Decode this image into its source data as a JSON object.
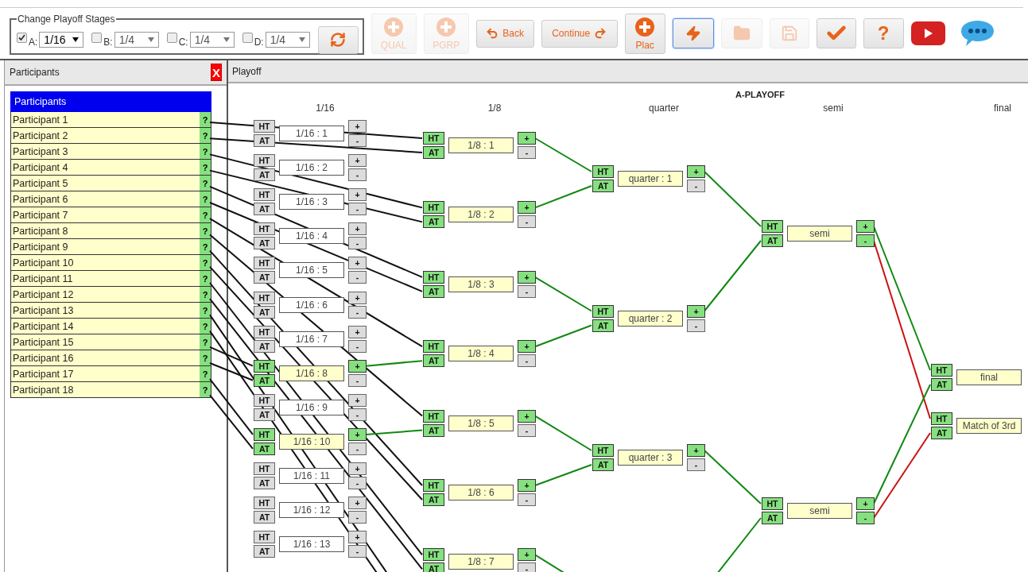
{
  "stage_panel": {
    "legend": "Change Playoff Stages",
    "stages": [
      {
        "letter": "A:",
        "checked": true,
        "value": "1/16"
      },
      {
        "letter": "B:",
        "checked": false,
        "value": "1/4"
      },
      {
        "letter": "C:",
        "checked": false,
        "value": "1/4"
      },
      {
        "letter": "D:",
        "checked": false,
        "value": "1/4"
      }
    ],
    "refresh_button": {
      "disabled": false
    }
  },
  "toolbar": [
    {
      "kind": "qual",
      "label": "QUAL",
      "disabled": true,
      "selected": false
    },
    {
      "kind": "pgrp",
      "label": "PGRP",
      "disabled": true,
      "selected": false
    },
    {
      "kind": "back",
      "label": "Back",
      "disabled": false,
      "selected": false
    },
    {
      "kind": "continue",
      "label": "Continue",
      "disabled": false,
      "selected": false
    },
    {
      "kind": "plac",
      "label": "Plac",
      "disabled": false,
      "selected": false
    },
    {
      "kind": "quick",
      "disabled": false,
      "selected": true
    },
    {
      "kind": "folder",
      "disabled": true,
      "selected": false
    },
    {
      "kind": "save",
      "disabled": true,
      "selected": false
    },
    {
      "kind": "check",
      "disabled": false,
      "selected": false
    },
    {
      "kind": "help",
      "label": "?",
      "disabled": false,
      "selected": false
    },
    {
      "kind": "video",
      "disabled": false,
      "selected": false
    },
    {
      "kind": "chat",
      "disabled": false,
      "selected": false
    }
  ],
  "participants_panel": {
    "title": "Participants",
    "close": "X",
    "list_title": "Participants",
    "items": [
      {
        "name": "Participant 1",
        "badge": "?"
      },
      {
        "name": "Participant 2",
        "badge": "?"
      },
      {
        "name": "Participant 3",
        "badge": "?"
      },
      {
        "name": "Participant 4",
        "badge": "?"
      },
      {
        "name": "Participant 5",
        "badge": "?"
      },
      {
        "name": "Participant 6",
        "badge": "?"
      },
      {
        "name": "Participant 7",
        "badge": "?"
      },
      {
        "name": "Participant 8",
        "badge": "?"
      },
      {
        "name": "Participant 9",
        "badge": "?"
      },
      {
        "name": "Participant 10",
        "badge": "?"
      },
      {
        "name": "Participant 11",
        "badge": "?"
      },
      {
        "name": "Participant 12",
        "badge": "?"
      },
      {
        "name": "Participant 13",
        "badge": "?"
      },
      {
        "name": "Participant 14",
        "badge": "?"
      },
      {
        "name": "Participant 15",
        "badge": "?"
      },
      {
        "name": "Participant 16",
        "badge": "?"
      },
      {
        "name": "Participant 17",
        "badge": "?"
      },
      {
        "name": "Participant 18",
        "badge": "?"
      }
    ]
  },
  "playoff_panel": {
    "title": "Playoff",
    "heading": "A-PLAYOFF",
    "rounds": [
      {
        "title": "1/16",
        "matches": [
          {
            "label": "1/16 : 1",
            "active": false,
            "ht": {
              "text": "HT",
              "on": false
            },
            "at": {
              "text": "AT",
              "on": false
            },
            "plus": {
              "text": "+",
              "on": false
            },
            "minus": {
              "text": "-",
              "on": false
            }
          },
          {
            "label": "1/16 : 2",
            "active": false,
            "ht": {
              "text": "HT",
              "on": false
            },
            "at": {
              "text": "AT",
              "on": false
            },
            "plus": {
              "text": "+",
              "on": false
            },
            "minus": {
              "text": "-",
              "on": false
            }
          },
          {
            "label": "1/16 : 3",
            "active": false,
            "ht": {
              "text": "HT",
              "on": false
            },
            "at": {
              "text": "AT",
              "on": false
            },
            "plus": {
              "text": "+",
              "on": false
            },
            "minus": {
              "text": "-",
              "on": false
            }
          },
          {
            "label": "1/16 : 4",
            "active": false,
            "ht": {
              "text": "HT",
              "on": false
            },
            "at": {
              "text": "AT",
              "on": false
            },
            "plus": {
              "text": "+",
              "on": false
            },
            "minus": {
              "text": "-",
              "on": false
            }
          },
          {
            "label": "1/16 : 5",
            "active": false,
            "ht": {
              "text": "HT",
              "on": false
            },
            "at": {
              "text": "AT",
              "on": false
            },
            "plus": {
              "text": "+",
              "on": false
            },
            "minus": {
              "text": "-",
              "on": false
            }
          },
          {
            "label": "1/16 : 6",
            "active": false,
            "ht": {
              "text": "HT",
              "on": false
            },
            "at": {
              "text": "AT",
              "on": false
            },
            "plus": {
              "text": "+",
              "on": false
            },
            "minus": {
              "text": "-",
              "on": false
            }
          },
          {
            "label": "1/16 : 7",
            "active": false,
            "ht": {
              "text": "HT",
              "on": false
            },
            "at": {
              "text": "AT",
              "on": false
            },
            "plus": {
              "text": "+",
              "on": false
            },
            "minus": {
              "text": "-",
              "on": false
            }
          },
          {
            "label": "1/16 : 8",
            "active": true,
            "ht": {
              "text": "HT",
              "on": true
            },
            "at": {
              "text": "AT",
              "on": true
            },
            "plus": {
              "text": "+",
              "on": true
            },
            "minus": {
              "text": "-",
              "on": false
            }
          },
          {
            "label": "1/16 : 9",
            "active": false,
            "ht": {
              "text": "HT",
              "on": false
            },
            "at": {
              "text": "AT",
              "on": false
            },
            "plus": {
              "text": "+",
              "on": false
            },
            "minus": {
              "text": "-",
              "on": false
            }
          },
          {
            "label": "1/16 : 10",
            "active": true,
            "ht": {
              "text": "HT",
              "on": true
            },
            "at": {
              "text": "AT",
              "on": true
            },
            "plus": {
              "text": "+",
              "on": true
            },
            "minus": {
              "text": "-",
              "on": false
            }
          },
          {
            "label": "1/16 : 11",
            "active": false,
            "ht": {
              "text": "HT",
              "on": false
            },
            "at": {
              "text": "AT",
              "on": false
            },
            "plus": {
              "text": "+",
              "on": false
            },
            "minus": {
              "text": "-",
              "on": false
            }
          },
          {
            "label": "1/16 : 12",
            "active": false,
            "ht": {
              "text": "HT",
              "on": false
            },
            "at": {
              "text": "AT",
              "on": false
            },
            "plus": {
              "text": "+",
              "on": false
            },
            "minus": {
              "text": "-",
              "on": false
            }
          },
          {
            "label": "1/16 : 13",
            "active": false,
            "ht": {
              "text": "HT",
              "on": false
            },
            "at": {
              "text": "AT",
              "on": false
            },
            "plus": {
              "text": "+",
              "on": false
            },
            "minus": {
              "text": "-",
              "on": false
            }
          }
        ]
      },
      {
        "title": "1/8",
        "matches": [
          {
            "label": "1/8 : 1",
            "active": true,
            "ht": {
              "text": "HT",
              "on": true
            },
            "at": {
              "text": "AT",
              "on": true
            },
            "plus": {
              "text": "+",
              "on": true
            },
            "minus": {
              "text": "-",
              "on": false
            }
          },
          {
            "label": "1/8 : 2",
            "active": true,
            "ht": {
              "text": "HT",
              "on": true
            },
            "at": {
              "text": "AT",
              "on": true
            },
            "plus": {
              "text": "+",
              "on": true
            },
            "minus": {
              "text": "-",
              "on": false
            }
          },
          {
            "label": "1/8 : 3",
            "active": true,
            "ht": {
              "text": "HT",
              "on": true
            },
            "at": {
              "text": "AT",
              "on": true
            },
            "plus": {
              "text": "+",
              "on": true
            },
            "minus": {
              "text": "-",
              "on": false
            }
          },
          {
            "label": "1/8 : 4",
            "active": true,
            "ht": {
              "text": "HT",
              "on": true
            },
            "at": {
              "text": "AT",
              "on": true
            },
            "plus": {
              "text": "+",
              "on": true
            },
            "minus": {
              "text": "-",
              "on": false
            }
          },
          {
            "label": "1/8 : 5",
            "active": true,
            "ht": {
              "text": "HT",
              "on": true
            },
            "at": {
              "text": "AT",
              "on": true
            },
            "plus": {
              "text": "+",
              "on": true
            },
            "minus": {
              "text": "-",
              "on": false
            }
          },
          {
            "label": "1/8 : 6",
            "active": true,
            "ht": {
              "text": "HT",
              "on": true
            },
            "at": {
              "text": "AT",
              "on": true
            },
            "plus": {
              "text": "+",
              "on": true
            },
            "minus": {
              "text": "-",
              "on": false
            }
          },
          {
            "label": "1/8 : 7",
            "active": true,
            "ht": {
              "text": "HT",
              "on": true
            },
            "at": {
              "text": "AT",
              "on": true
            },
            "plus": {
              "text": "+",
              "on": true
            },
            "minus": {
              "text": "-",
              "on": false
            }
          }
        ]
      },
      {
        "title": "quarter",
        "matches": [
          {
            "label": "quarter : 1",
            "active": true,
            "ht": {
              "text": "HT",
              "on": true
            },
            "at": {
              "text": "AT",
              "on": true
            },
            "plus": {
              "text": "+",
              "on": true
            },
            "minus": {
              "text": "-",
              "on": false
            }
          },
          {
            "label": "quarter : 2",
            "active": true,
            "ht": {
              "text": "HT",
              "on": true
            },
            "at": {
              "text": "AT",
              "on": true
            },
            "plus": {
              "text": "+",
              "on": true
            },
            "minus": {
              "text": "-",
              "on": false
            }
          },
          {
            "label": "quarter : 3",
            "active": true,
            "ht": {
              "text": "HT",
              "on": true
            },
            "at": {
              "text": "AT",
              "on": true
            },
            "plus": {
              "text": "+",
              "on": true
            },
            "minus": {
              "text": "-",
              "on": false
            }
          }
        ]
      },
      {
        "title": "semi",
        "matches": [
          {
            "label": "semi",
            "active": true,
            "ht": {
              "text": "HT",
              "on": true
            },
            "at": {
              "text": "AT",
              "on": true
            },
            "plus": {
              "text": "+",
              "on": true
            },
            "minus": {
              "text": "-",
              "on": true
            }
          },
          {
            "label": "semi",
            "active": true,
            "ht": {
              "text": "HT",
              "on": true
            },
            "at": {
              "text": "AT",
              "on": true
            },
            "plus": {
              "text": "+",
              "on": true
            },
            "minus": {
              "text": "-",
              "on": true
            }
          }
        ]
      },
      {
        "title": "final",
        "matches": [
          {
            "label": "final",
            "active": true,
            "ht": {
              "text": "HT",
              "on": true
            },
            "at": {
              "text": "AT",
              "on": true
            }
          },
          {
            "label": "Match of 3rd",
            "active": true,
            "ht": {
              "text": "HT",
              "on": true
            },
            "at": {
              "text": "AT",
              "on": true
            }
          }
        ]
      }
    ]
  }
}
